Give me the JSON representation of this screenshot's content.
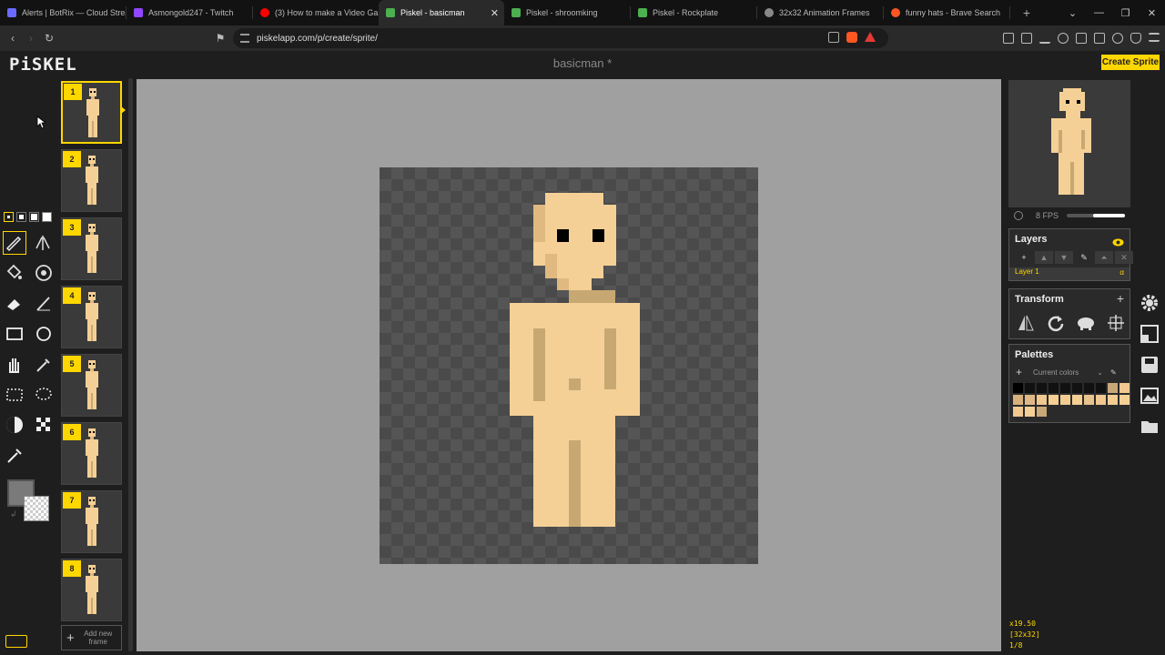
{
  "browser": {
    "tabs": [
      {
        "label": "Alerts | BotRix — Cloud Stream",
        "color": "#6a6aff"
      },
      {
        "label": "Asmongold247 - Twitch",
        "color": "#9146ff"
      },
      {
        "label": "(3) How to make a Video Gam",
        "color": "#ff0000"
      },
      {
        "label": "Piskel - basicman",
        "color": "#4caf50",
        "active": true
      },
      {
        "label": "Piskel - shroomking",
        "color": "#4caf50"
      },
      {
        "label": "Piskel - Rockplate",
        "color": "#4caf50"
      },
      {
        "label": "32x32 Animation Frames",
        "color": "#888888"
      },
      {
        "label": "funny hats - Brave Search",
        "color": "#ff5722"
      }
    ],
    "url": "piskelapp.com/p/create/sprite/"
  },
  "app": {
    "logo": "PiSKEL",
    "title": "basicman *",
    "create_label": "Create Sprite",
    "accent": "#ffd700"
  },
  "frames": {
    "items": [
      "1",
      "2",
      "3",
      "4",
      "5",
      "6",
      "7",
      "8"
    ],
    "selected": "1",
    "add_label": "Add new frame"
  },
  "tools": {
    "primary_color": "#7a7a7a",
    "secondary_color": "transparent",
    "icons": [
      "pen-icon",
      "mirror-pen-icon",
      "paint-bucket-icon",
      "magic-wand-icon",
      "eraser-icon",
      "stroke-icon",
      "rectangle-icon",
      "circle-icon",
      "hand-icon",
      "color-picker-icon",
      "rect-select-icon",
      "lasso-select-icon",
      "lighten-icon",
      "dither-icon",
      "eyedropper-icon"
    ]
  },
  "preview": {
    "fps_label": "8 FPS",
    "fps_level": 0.55
  },
  "layers": {
    "title": "Layers",
    "items": [
      {
        "name": "Layer 1",
        "alpha": "α"
      }
    ]
  },
  "transform": {
    "title": "Transform"
  },
  "palettes": {
    "title": "Palettes",
    "current": "Current colors",
    "colors": [
      "#000000",
      "#111111",
      "#111111",
      "#111111",
      "#111111",
      "#111111",
      "#111111",
      "#111111",
      "#c8a878",
      "#f0c890",
      "#d8b07c",
      "#e0b888",
      "#f0c890",
      "#f5cf94",
      "#f2cc91",
      "#f5d095",
      "#e8c48c",
      "#f0c890",
      "#f3cd92",
      "#f5d096",
      "#f0c890",
      "#f5d096",
      "#c8a878"
    ]
  },
  "status": {
    "zoom": "x19.50",
    "size": "[32x32]",
    "frame": "1/8"
  }
}
